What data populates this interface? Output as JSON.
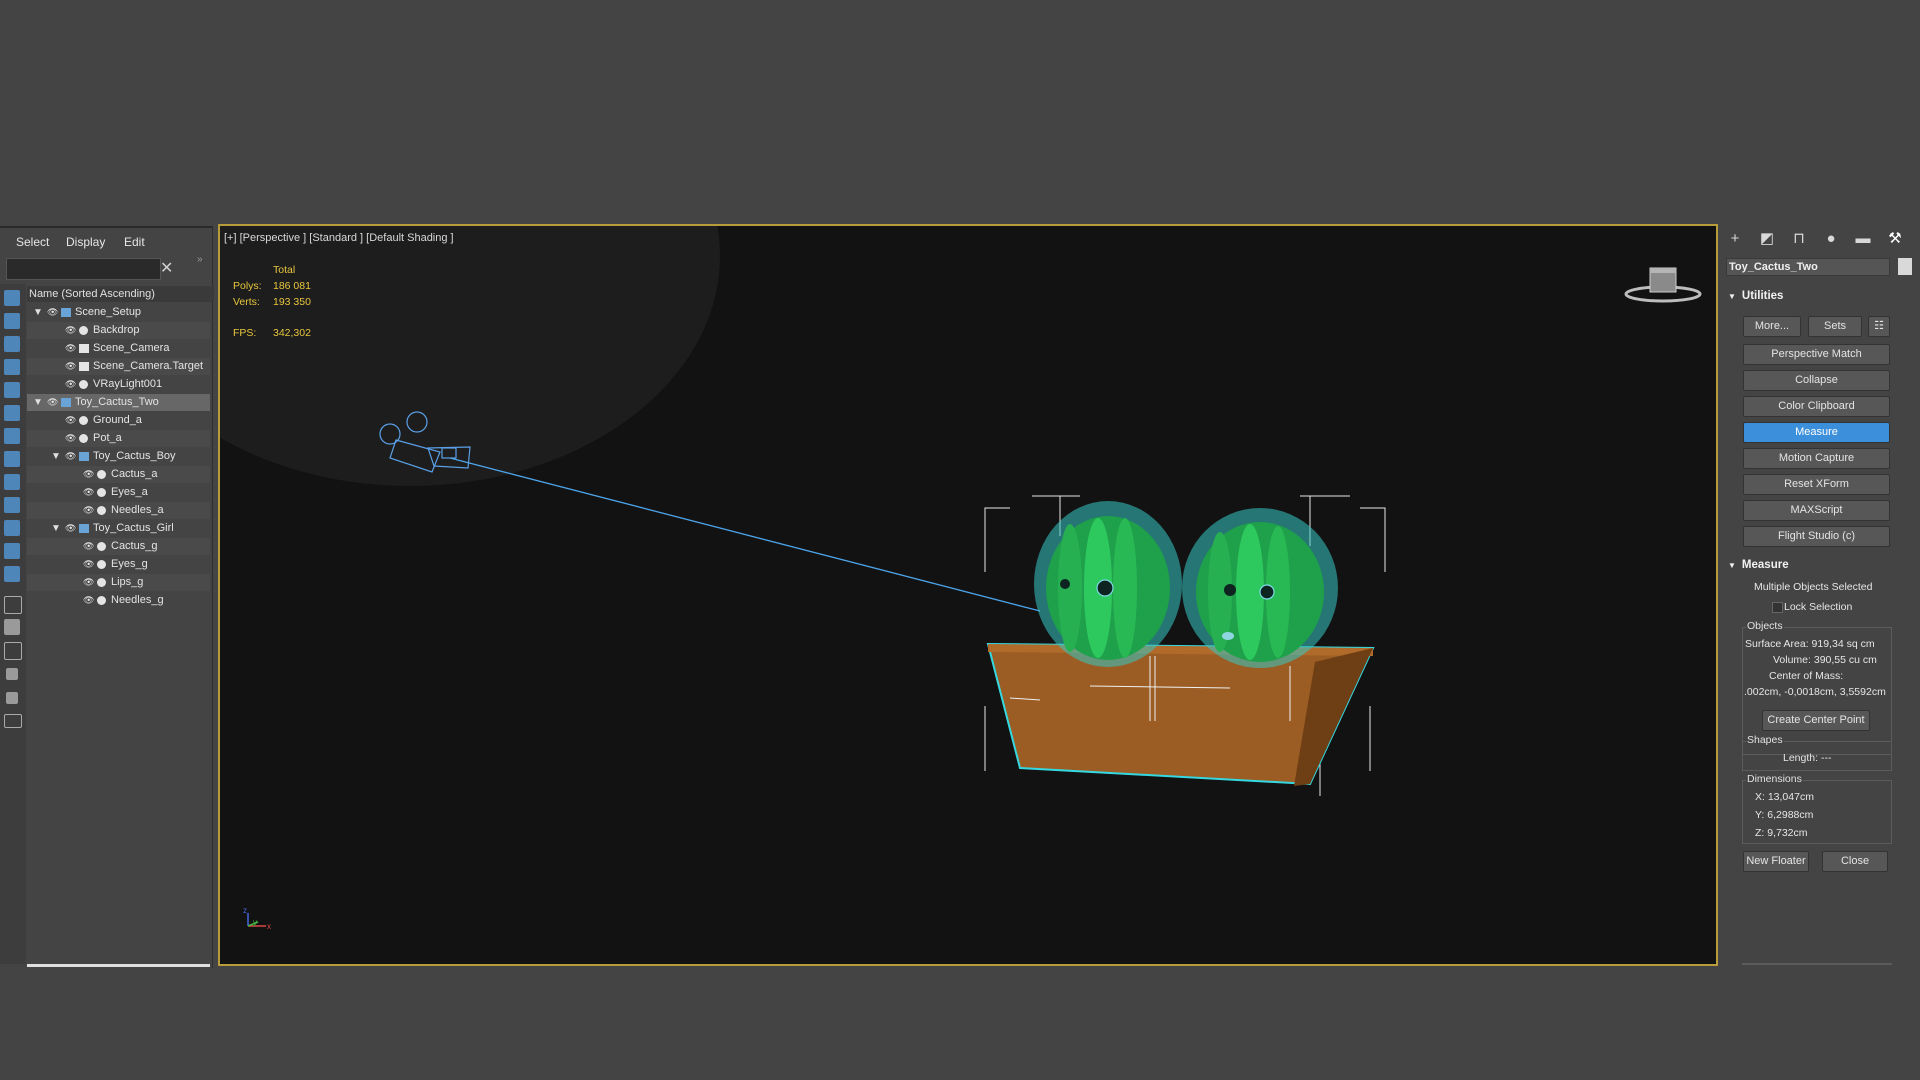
{
  "explorer": {
    "menu": [
      "Select",
      "Display",
      "Edit"
    ],
    "search": {
      "value": "",
      "placeholder": ""
    },
    "column_header": "Name (Sorted Ascending)",
    "tree": [
      {
        "label": "Scene_Setup",
        "depth": 0,
        "expand": true,
        "icon": "layer-icon"
      },
      {
        "label": "Backdrop",
        "depth": 1,
        "icon": "geometry-icon"
      },
      {
        "label": "Scene_Camera",
        "depth": 1,
        "icon": "camera-icon"
      },
      {
        "label": "Scene_Camera.Target",
        "depth": 1,
        "icon": "camera-icon"
      },
      {
        "label": "VRayLight001",
        "depth": 1,
        "icon": "light-icon"
      },
      {
        "label": "Toy_Cactus_Two",
        "depth": 0,
        "expand": true,
        "icon": "layer-icon",
        "selected": true
      },
      {
        "label": "Ground_a",
        "depth": 1,
        "icon": "geometry-icon"
      },
      {
        "label": "Pot_a",
        "depth": 1,
        "icon": "geometry-icon"
      },
      {
        "label": "Toy_Cactus_Boy",
        "depth": 1,
        "expand": true,
        "icon": "layer-icon"
      },
      {
        "label": "Cactus_a",
        "depth": 2,
        "icon": "geometry-icon"
      },
      {
        "label": "Eyes_a",
        "depth": 2,
        "icon": "geometry-icon"
      },
      {
        "label": "Needles_a",
        "depth": 2,
        "icon": "geometry-icon"
      },
      {
        "label": "Toy_Cactus_Girl",
        "depth": 1,
        "expand": true,
        "icon": "layer-icon"
      },
      {
        "label": "Cactus_g",
        "depth": 2,
        "icon": "geometry-icon"
      },
      {
        "label": "Eyes_g",
        "depth": 2,
        "icon": "geometry-icon"
      },
      {
        "label": "Lips_g",
        "depth": 2,
        "icon": "geometry-icon"
      },
      {
        "label": "Needles_g",
        "depth": 2,
        "icon": "geometry-icon"
      }
    ]
  },
  "viewport": {
    "label": "[+] [Perspective ] [Standard ] [Default Shading ]",
    "stats": {
      "total_label": "Total",
      "polys_label": "Polys:",
      "polys_value": "186 081",
      "verts_label": "Verts:",
      "verts_value": "193 350",
      "fps_label": "FPS:",
      "fps_value": "342,302"
    },
    "border_color": "#b89b3a",
    "highlight_color": "#35d8e0"
  },
  "command_panel": {
    "tabs": [
      "create-tab",
      "modify-tab",
      "hierarchy-tab",
      "motion-tab",
      "display-tab",
      "utilities-tab"
    ],
    "object_name": "Toy_Cactus_Two",
    "utilities": {
      "title": "Utilities",
      "more_label": "More...",
      "sets_label": "Sets",
      "buttons": [
        "Perspective Match",
        "Collapse",
        "Color Clipboard",
        "Measure",
        "Motion Capture",
        "Reset XForm",
        "MAXScript",
        "Flight Studio (c)"
      ],
      "active": "Measure"
    },
    "measure": {
      "title": "Measure",
      "status": "Multiple Objects Selected",
      "lock_selection": "Lock Selection",
      "objects_group": "Objects",
      "surface_area": "Surface Area:  919,34 sq cm",
      "volume": "Volume:  390,55 cu cm",
      "center_of_mass_label": "Center of Mass:",
      "center_of_mass_value": ".002cm, -0,0018cm, 3,5592cm",
      "create_center_point": "Create Center Point",
      "shapes_group": "Shapes",
      "length": "Length:  ---",
      "dimensions_group": "Dimensions",
      "dim_x": "X:    13,047cm",
      "dim_y": "Y:    6,2988cm",
      "dim_z": "Z:    9,732cm",
      "new_floater": "New Floater",
      "close": "Close"
    },
    "accent_color": "#3b8fdb"
  }
}
